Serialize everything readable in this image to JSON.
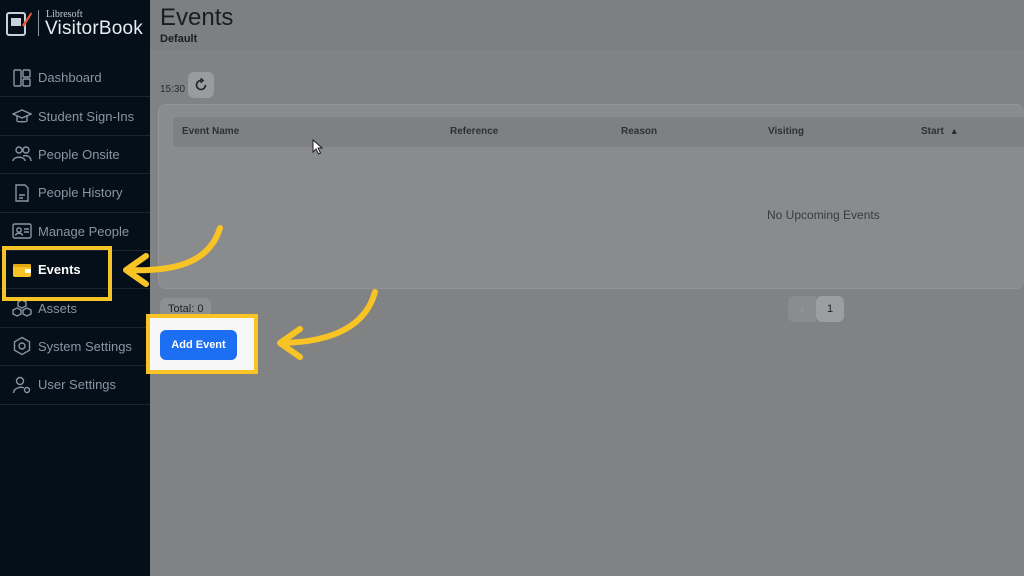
{
  "brand": {
    "sub": "Libresoft",
    "name": "VisitorBook"
  },
  "sidebar": {
    "items": [
      {
        "label": "Dashboard",
        "icon": "dashboard-icon"
      },
      {
        "label": "Student Sign-Ins",
        "icon": "graduation-cap-icon"
      },
      {
        "label": "People Onsite",
        "icon": "people-icon"
      },
      {
        "label": "People History",
        "icon": "document-icon"
      },
      {
        "label": "Manage People",
        "icon": "id-card-icon"
      },
      {
        "label": "Events",
        "icon": "wallet-icon",
        "active": true
      },
      {
        "label": "Assets",
        "icon": "boxes-icon"
      },
      {
        "label": "System Settings",
        "icon": "gear-icon"
      },
      {
        "label": "User Settings",
        "icon": "user-gear-icon"
      }
    ]
  },
  "header": {
    "title": "Events",
    "subtitle": "Default"
  },
  "toolbar": {
    "time": "15:30",
    "refresh_icon": "refresh-icon"
  },
  "table": {
    "columns": [
      "Event Name",
      "Reference",
      "Reason",
      "Visiting",
      "Start"
    ],
    "empty_text": "No Upcoming Events"
  },
  "footer": {
    "total": "Total: 0",
    "prev": "‹",
    "page": "1"
  },
  "actions": {
    "add_event": "Add Event"
  },
  "colors": {
    "highlight": "#f7c325",
    "primary": "#1c6ef2",
    "sidebar": "#040f1a"
  }
}
